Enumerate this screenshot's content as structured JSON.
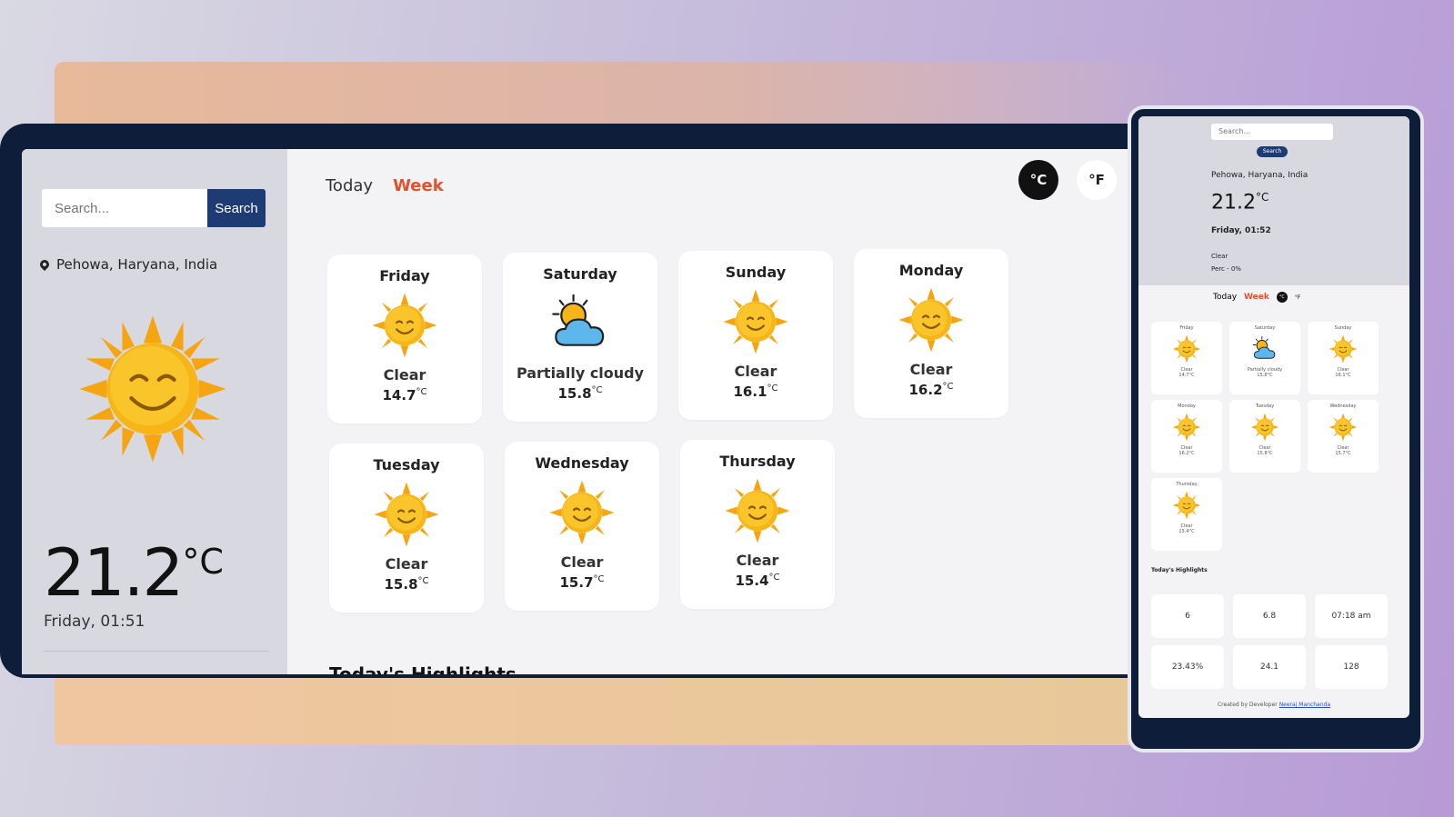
{
  "search": {
    "placeholder": "Search...",
    "button_label": "Search"
  },
  "location": "Pehowa, Haryana, India",
  "current": {
    "temp": "21.2",
    "unit": "°C",
    "datetime": "Friday, 01:51"
  },
  "tabs": {
    "today": "Today",
    "week": "Week"
  },
  "units": {
    "c": "°C",
    "f": "°F"
  },
  "forecast": [
    {
      "day": "Friday",
      "condition": "Clear",
      "temp": "14.7",
      "icon": "sun-icon"
    },
    {
      "day": "Saturday",
      "condition": "Partially cloudy",
      "temp": "15.8",
      "icon": "partly-cloudy-icon"
    },
    {
      "day": "Sunday",
      "condition": "Clear",
      "temp": "16.1",
      "icon": "sun-icon"
    },
    {
      "day": "Monday",
      "condition": "Clear",
      "temp": "16.2",
      "icon": "sun-icon"
    },
    {
      "day": "Tuesday",
      "condition": "Clear",
      "temp": "15.8",
      "icon": "sun-icon"
    },
    {
      "day": "Wednesday",
      "condition": "Clear",
      "temp": "15.7",
      "icon": "sun-icon"
    },
    {
      "day": "Thursday",
      "condition": "Clear",
      "temp": "15.4",
      "icon": "sun-icon"
    }
  ],
  "temp_unit_sup": "°C",
  "highlights_title": "Today's Highlights",
  "phone": {
    "search_placeholder": "Search...",
    "search_button": "Search",
    "location": "Pehowa, Haryana, India",
    "temp": "21.2",
    "unit": "°C",
    "datetime": "Friday, 01:52",
    "condition": "Clear",
    "precip": "Perc - 0%",
    "tab_today": "Today",
    "tab_week": "Week",
    "unit_c": "°C",
    "unit_f": "°F",
    "highlights_title": "Today's Highlights",
    "highlights": [
      "6",
      "6.8",
      "07:18 am",
      "23.43%",
      "24.1",
      "128"
    ],
    "footer_prefix": "Created by Developer",
    "footer_link": "Neeraj Manchanda"
  }
}
